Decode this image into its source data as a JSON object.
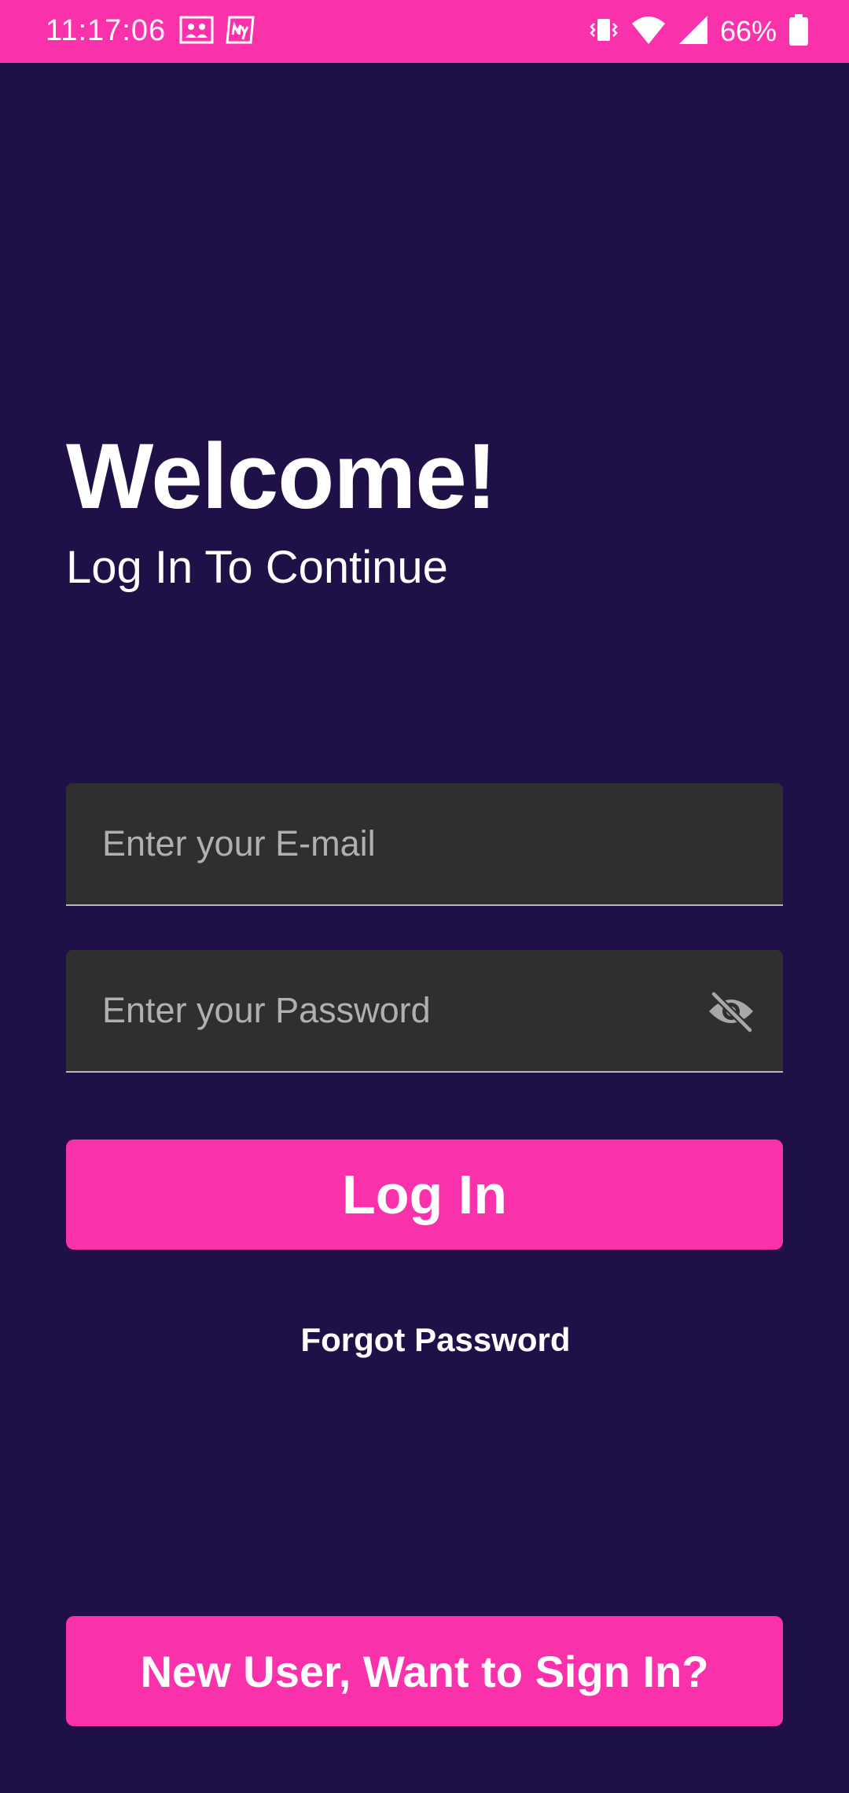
{
  "status_bar": {
    "time": "11:17:06",
    "battery_percent": "66%",
    "left_icons": [
      "gallery-notification-icon",
      "myntra-notification-icon"
    ],
    "right_icons": [
      "vibrate-icon",
      "wifi-icon",
      "cell-signal-icon",
      "battery-icon"
    ],
    "color": "#f932ab"
  },
  "header": {
    "title": "Welcome!",
    "subtitle": "Log In To Continue"
  },
  "form": {
    "email_placeholder": "Enter your E-mail",
    "email_value": "",
    "password_placeholder": "Enter your Password",
    "password_value": "",
    "password_toggle_icon": "visibility-off-icon",
    "login_label": "Log In",
    "forgot_label": "Forgot Password"
  },
  "footer": {
    "signup_label": "New User, Want to Sign In?"
  },
  "colors": {
    "background": "#1f1147",
    "accent": "#f932ab",
    "input_background": "#2f2f2f",
    "placeholder": "#b0b0b0"
  }
}
